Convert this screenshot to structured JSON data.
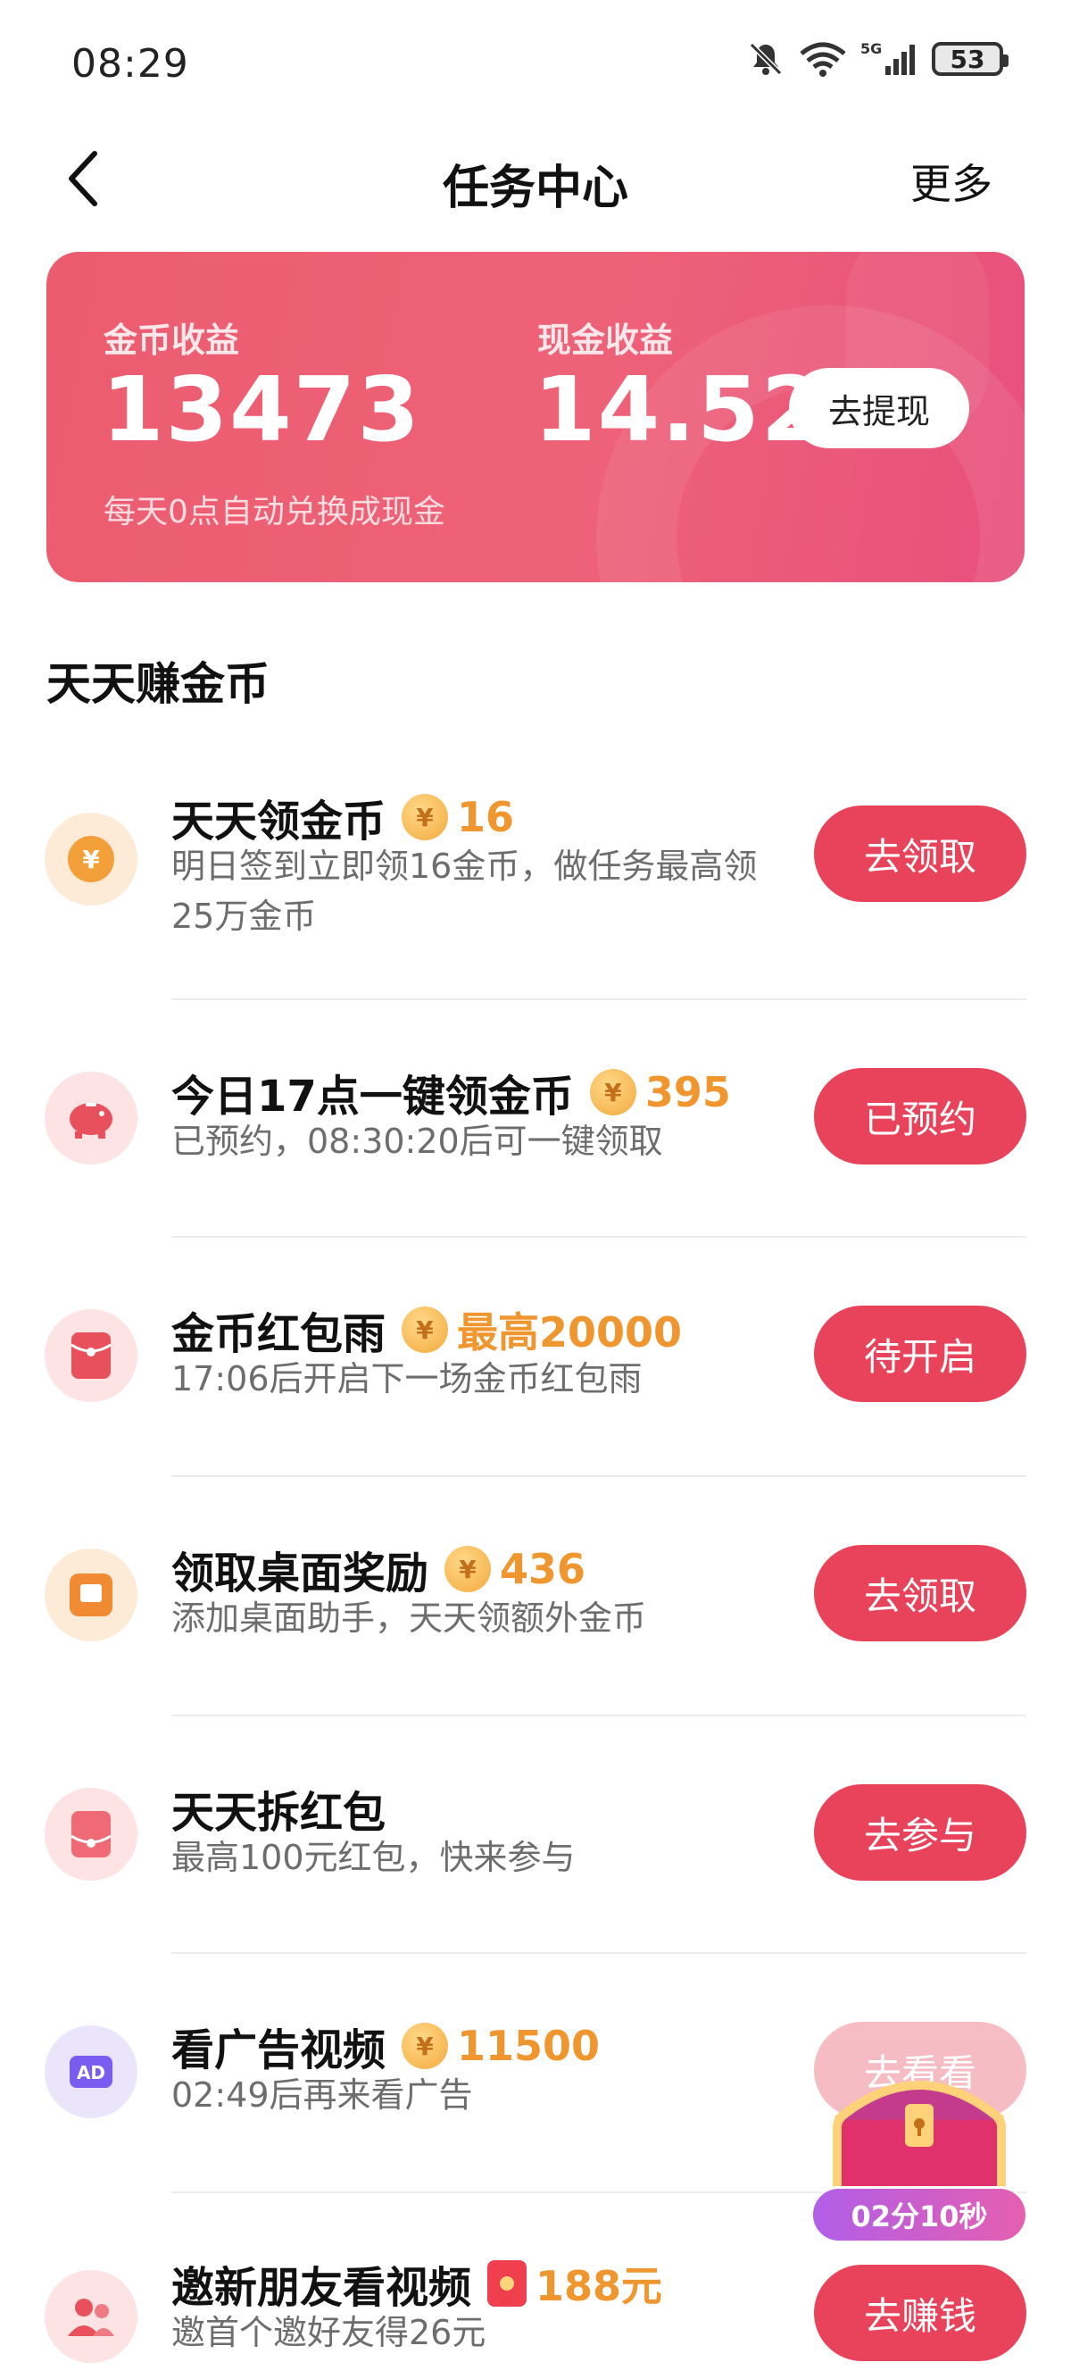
{
  "status_bar": {
    "time": "08:29",
    "battery": "53"
  },
  "nav": {
    "title": "任务中心",
    "more": "更多"
  },
  "earnings": {
    "coin_label": "金币收益",
    "coin_value": "13473",
    "coin_note": "每天0点自动兑换成现金",
    "cash_label": "现金收益",
    "cash_value": "14.52",
    "withdraw_label": "去提现"
  },
  "section_title": "天天赚金币",
  "tasks": [
    {
      "title": "天天领金币",
      "reward": "16",
      "desc": "明日签到立即领16金币，做任务最高领25万金币",
      "button": "去领取",
      "icon": "coin-icon"
    },
    {
      "title": "今日17点一键领金币",
      "reward": "395",
      "desc": "已预约，08:30:20后可一键领取",
      "button": "已预约",
      "icon": "piggy-bank-icon"
    },
    {
      "title": "金币红包雨",
      "reward": "最高20000",
      "desc": "17:06后开启下一场金币红包雨",
      "button": "待开启",
      "icon": "red-packet-icon"
    },
    {
      "title": "领取桌面奖励",
      "reward": "436",
      "desc": "添加桌面助手，天天领额外金币",
      "button": "去领取",
      "icon": "desktop-widget-icon"
    },
    {
      "title": "天天拆红包",
      "reward": "",
      "desc": "最高100元红包，快来参与",
      "button": "去参与",
      "icon": "open-red-packet-icon"
    },
    {
      "title": "看广告视频",
      "reward": "11500",
      "desc": "02:49后再来看广告",
      "button": "去看看",
      "icon": "ad-icon"
    },
    {
      "title": "邀新朋友看视频",
      "reward": "188元",
      "desc": "邀首个邀好友得26元",
      "button": "去赚钱",
      "icon": "invite-friends-icon"
    }
  ],
  "chest": {
    "timer": "02分10秒"
  },
  "colors": {
    "accent": "#e8435a",
    "card_gradient_start": "#ec5c6f",
    "card_gradient_end": "#e8507c",
    "reward_orange": "#f0962e"
  }
}
